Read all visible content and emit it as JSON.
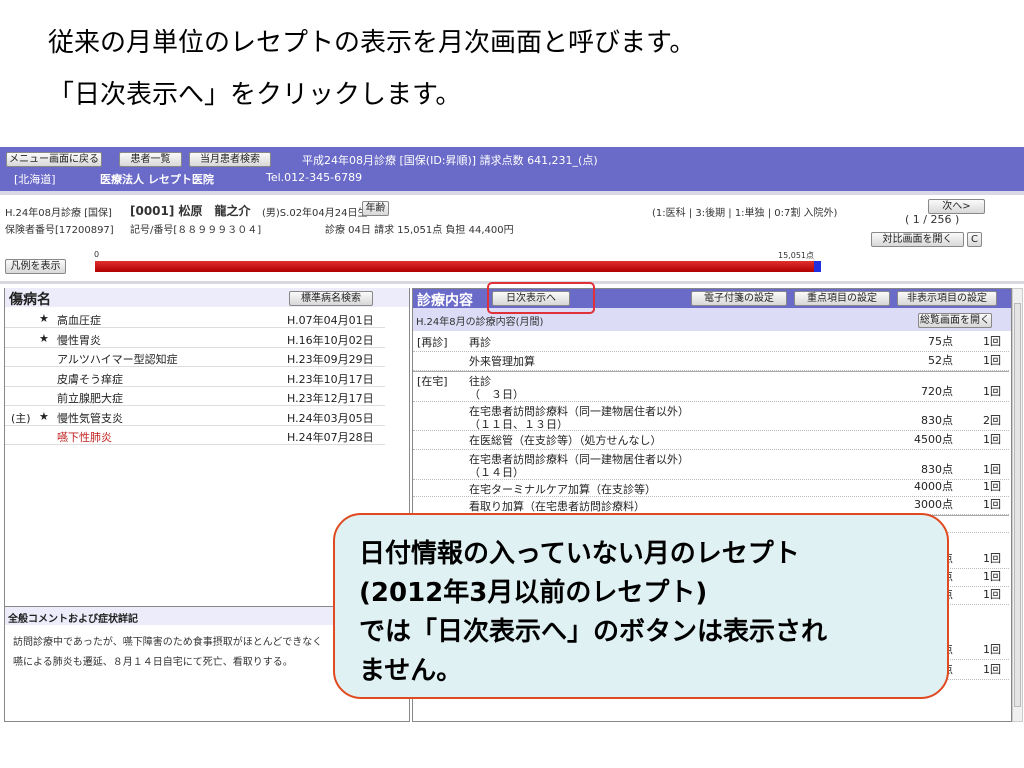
{
  "slide": {
    "title_line1": "従来の月単位のレセプトの表示を月次画面と呼びます。",
    "title_line2": "「日次表示へ」をクリックします。"
  },
  "topbar": {
    "menu_button": "メニュー画面に戻る",
    "patient_list_button": "患者一覧",
    "month_search_button": "当月患者検索",
    "claim_info": "平成24年08月診療 [国保(ID:昇順)] 請求点数 641,231_(点)",
    "prefecture": "[北海道]",
    "clinic_name": "医療法人 レセプト医院",
    "tel": "Tel.012-345-6789"
  },
  "patient": {
    "period": "H.24年08月診療 [国保]",
    "id_name": "[0001] 松原　龍之介",
    "sex_birth": "(男)S.02年04月24日生",
    "age_button": "年齢",
    "insurer": "保険者番号[17200897]",
    "card_no": "記号/番号[８８９９９３０４]",
    "summary": "診療 04日 請求 15,051点 負担 44,400円",
    "category": "(1:医科 | 3:後期 | 1:単独 | 0:7割 入院外)",
    "next_button": "次へ>",
    "page_counter": "( 1 / 256 )",
    "compare_button": "対比画面を開く",
    "c_button": "C",
    "legend_button": "凡例を表示",
    "bar_min": "0",
    "bar_max": "15,051点",
    "bar_fill_fraction": 0.99
  },
  "diseases": {
    "title": "傷病名",
    "search_button": "標準病名検索",
    "items": [
      {
        "prefix": "",
        "star": "★",
        "name": "高血圧症",
        "date": "H.07年04月01日",
        "color": "#222"
      },
      {
        "prefix": "",
        "star": "★",
        "name": "慢性胃炎",
        "date": "H.16年10月02日",
        "color": "#222"
      },
      {
        "prefix": "",
        "star": "",
        "name": "アルツハイマー型認知症",
        "date": "H.23年09月29日",
        "color": "#222"
      },
      {
        "prefix": "",
        "star": "",
        "name": "皮膚そう痒症",
        "date": "H.23年10月17日",
        "color": "#222"
      },
      {
        "prefix": "",
        "star": "",
        "name": "前立腺肥大症",
        "date": "H.23年12月17日",
        "color": "#222"
      },
      {
        "prefix": "(主)",
        "star": "★",
        "name": "慢性気管支炎",
        "date": "H.24年03月05日",
        "color": "#222"
      },
      {
        "prefix": "",
        "star": "",
        "name": "嚥下性肺炎",
        "date": "H.24年07月28日",
        "color": "#c02020"
      }
    ]
  },
  "comment": {
    "title": "全般コメントおよび症状詳記",
    "line1": "訪問診療中であったが、嚥下障害のため食事摂取がほとんどできなく",
    "line2": "嚥による肺炎も遷延、８月１４日自宅にて死亡、看取りする。"
  },
  "treatment": {
    "title": "診療内容",
    "daily_button": "日次表示へ",
    "tag_button": "電子付箋の設定",
    "priority_button": "重点項目の設定",
    "hidden_button": "非表示項目の設定",
    "subtitle": "H.24年8月の診療内容(月間)",
    "overview_button": "総覧画面を開く",
    "rows": [
      {
        "cat": "[再診]",
        "name": "再診",
        "points": "75点",
        "count": "1回",
        "h": 19
      },
      {
        "cat": "",
        "name": "外来管理加算",
        "points": "52点",
        "count": "1回",
        "h": 19
      },
      {
        "cat": "[在宅]",
        "name": "往診\n（　３日）",
        "points": "720点",
        "count": "1回",
        "h": 31
      },
      {
        "cat": "",
        "name": "在宅患者訪問診療料（同一建物居住者以外）\n（１１日、１３日）",
        "points": "830点",
        "count": "2回",
        "h": 29
      },
      {
        "cat": "",
        "name": "在医総管（在支診等）（処方せんなし）",
        "points": "4500点",
        "count": "1回",
        "h": 19
      },
      {
        "cat": "",
        "name": "在宅患者訪問診療料（同一建物居住者以外）\n（１４日）",
        "points": "830点",
        "count": "1回",
        "h": 30
      },
      {
        "cat": "",
        "name": "在宅ターミナルケア加算（在支診等）",
        "points": "4000点",
        "count": "1回",
        "h": 17
      },
      {
        "cat": "",
        "name": "看取り加算（在宅患者訪問診療料）",
        "points": "3000点",
        "count": "1回",
        "h": 18
      },
      {
        "cat": "",
        "name": "",
        "points": "",
        "count": "",
        "h": 18
      },
      {
        "cat": "",
        "name": "",
        "points": "点",
        "count": "1回",
        "h": 36
      },
      {
        "cat": "",
        "name": "",
        "points": "点",
        "count": "1回",
        "h": 18
      },
      {
        "cat": "",
        "name": "",
        "points": "点",
        "count": "1回",
        "h": 18
      },
      {
        "cat": "",
        "name": "",
        "points": "点",
        "count": "1回",
        "h": 55
      },
      {
        "cat": "",
        "name": "",
        "points": "点",
        "count": "1回",
        "h": 20
      }
    ]
  },
  "callout": {
    "line1": "日付情報の入っていない月のレセプト",
    "line2": "(2012年3月以前のレセプト)",
    "line3": "では「日次表示へ」のボタンは表示され",
    "line4": "ません。"
  },
  "colors": {
    "topbar": "#6a6ac8",
    "bar_red": "#cc0000",
    "highlight": "#e04a20"
  }
}
